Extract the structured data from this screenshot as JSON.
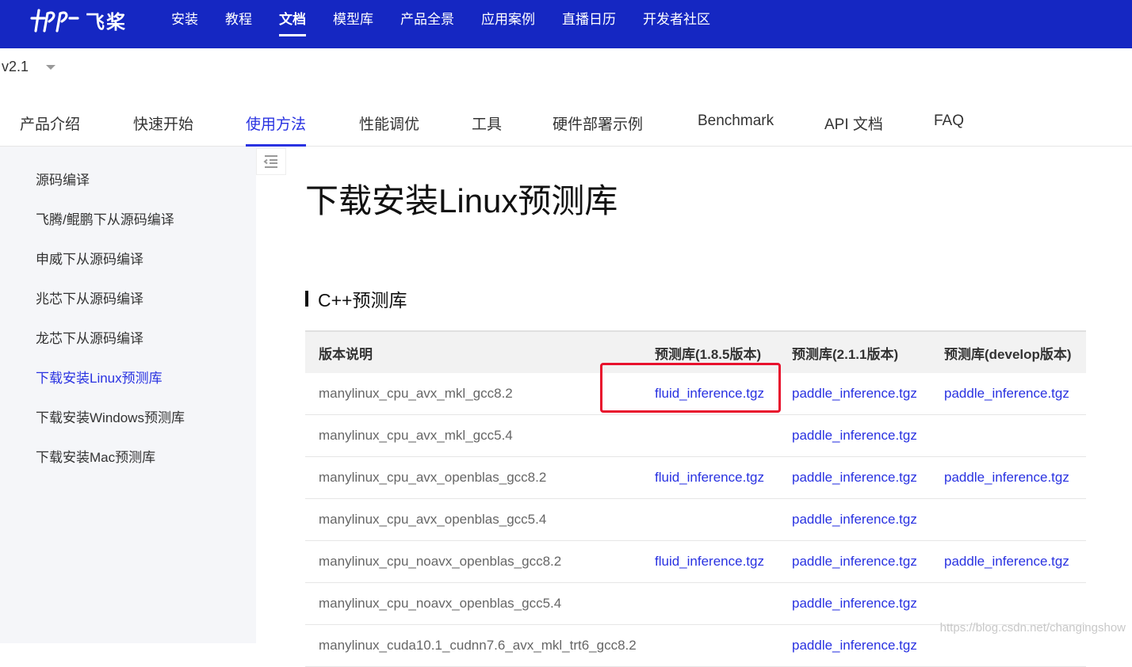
{
  "logo": {
    "text": "飞桨"
  },
  "top_nav": [
    {
      "label": "安装",
      "active": false
    },
    {
      "label": "教程",
      "active": false
    },
    {
      "label": "文档",
      "active": true
    },
    {
      "label": "模型库",
      "active": false
    },
    {
      "label": "产品全景",
      "active": false
    },
    {
      "label": "应用案例",
      "active": false
    },
    {
      "label": "直播日历",
      "active": false
    },
    {
      "label": "开发者社区",
      "active": false
    }
  ],
  "version": {
    "selected": "v2.1"
  },
  "sub_tabs": [
    {
      "label": "产品介绍",
      "active": false
    },
    {
      "label": "快速开始",
      "active": false
    },
    {
      "label": "使用方法",
      "active": true
    },
    {
      "label": "性能调优",
      "active": false
    },
    {
      "label": "工具",
      "active": false
    },
    {
      "label": "硬件部署示例",
      "active": false
    },
    {
      "label": "Benchmark",
      "active": false
    },
    {
      "label": "API 文档",
      "active": false
    },
    {
      "label": "FAQ",
      "active": false
    }
  ],
  "sidebar": {
    "items": [
      {
        "label": "源码编译",
        "active": false
      },
      {
        "label": "飞腾/鲲鹏下从源码编译",
        "active": false
      },
      {
        "label": "申威下从源码编译",
        "active": false
      },
      {
        "label": "兆芯下从源码编译",
        "active": false
      },
      {
        "label": "龙芯下从源码编译",
        "active": false
      },
      {
        "label": "下载安装Linux预测库",
        "active": true
      },
      {
        "label": "下载安装Windows预测库",
        "active": false
      },
      {
        "label": "下载安装Mac预测库",
        "active": false
      }
    ]
  },
  "main": {
    "title": "下载安装Linux预测库",
    "section_title": "C++预测库",
    "table": {
      "headers": [
        "版本说明",
        "预测库(1.8.5版本)",
        "预测库(2.1.1版本)",
        "预测库(develop版本)"
      ],
      "rows": [
        [
          "manylinux_cpu_avx_mkl_gcc8.2",
          "fluid_inference.tgz",
          "paddle_inference.tgz",
          "paddle_inference.tgz"
        ],
        [
          "manylinux_cpu_avx_mkl_gcc5.4",
          "",
          "paddle_inference.tgz",
          ""
        ],
        [
          "manylinux_cpu_avx_openblas_gcc8.2",
          "fluid_inference.tgz",
          "paddle_inference.tgz",
          "paddle_inference.tgz"
        ],
        [
          "manylinux_cpu_avx_openblas_gcc5.4",
          "",
          "paddle_inference.tgz",
          ""
        ],
        [
          "manylinux_cpu_noavx_openblas_gcc8.2",
          "fluid_inference.tgz",
          "paddle_inference.tgz",
          "paddle_inference.tgz"
        ],
        [
          "manylinux_cpu_noavx_openblas_gcc5.4",
          "",
          "paddle_inference.tgz",
          ""
        ],
        [
          "manylinux_cuda10.1_cudnn7.6_avx_mkl_trt6_gcc8.2",
          "",
          "paddle_inference.tgz",
          ""
        ]
      ]
    }
  },
  "watermark": "https://blog.csdn.net/changingshow",
  "colors": {
    "topbar": "#1527c2",
    "accent": "#2932e1",
    "highlight_box": "#e8112d",
    "sidebar_bg": "#f5f6f9"
  }
}
